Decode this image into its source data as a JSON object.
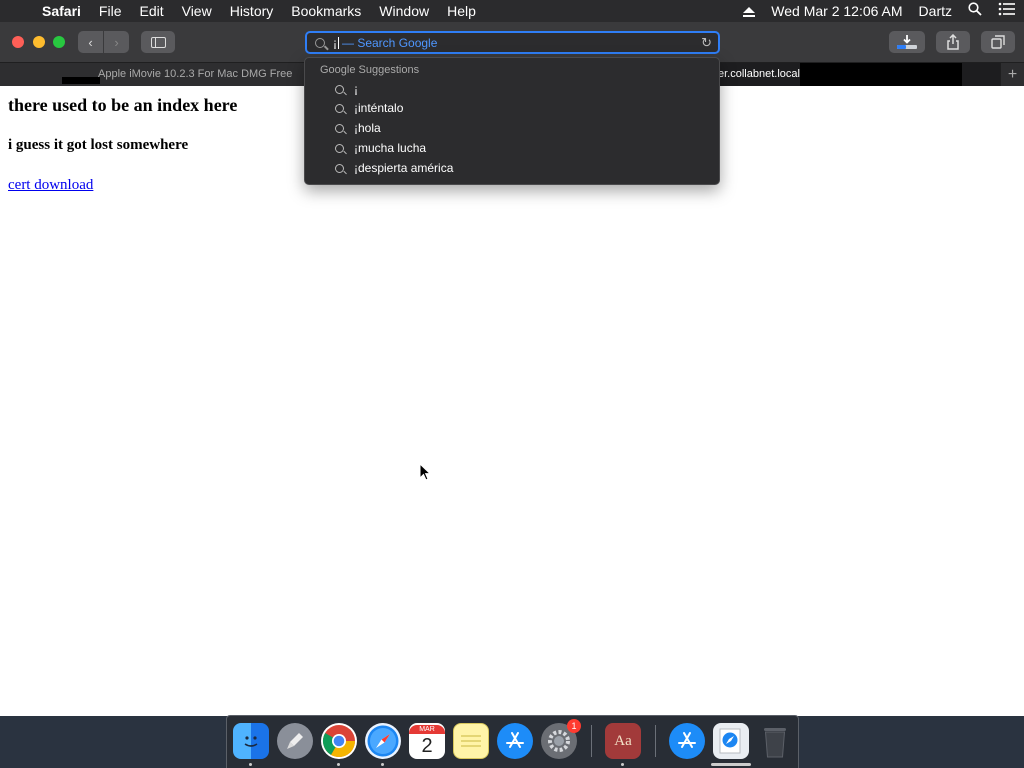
{
  "menubar": {
    "apple": "",
    "items": [
      "Safari",
      "File",
      "Edit",
      "View",
      "History",
      "Bookmarks",
      "Window",
      "Help"
    ],
    "clock": "Wed Mar 2  12:06 AM",
    "user": "Dartz"
  },
  "toolbar": {
    "back_glyph": "‹",
    "forward_glyph": "›",
    "address_typed": "¡",
    "address_hint": "— Search Google",
    "reload_glyph": "↻"
  },
  "tabs": [
    {
      "title": "Apple iMovie 10.2.3 For Mac DMG Free"
    },
    {
      "title": "er.collabnet.local"
    }
  ],
  "page": {
    "heading": "there used to be an index here",
    "subheading": "i guess it got lost somewhere",
    "link": "cert download"
  },
  "suggestions": {
    "header": "Google Suggestions",
    "items": [
      "¡",
      "¡inténtalo",
      "¡hola",
      "¡mucha lucha",
      "¡despierta américa"
    ]
  },
  "dock": {
    "calendar_month": "MAR",
    "calendar_day": "2",
    "dictionary_label": "Aa",
    "system_prefs_badge": "1"
  },
  "colors": {
    "accent": "#2f7ef6",
    "link": "#0000ee"
  }
}
